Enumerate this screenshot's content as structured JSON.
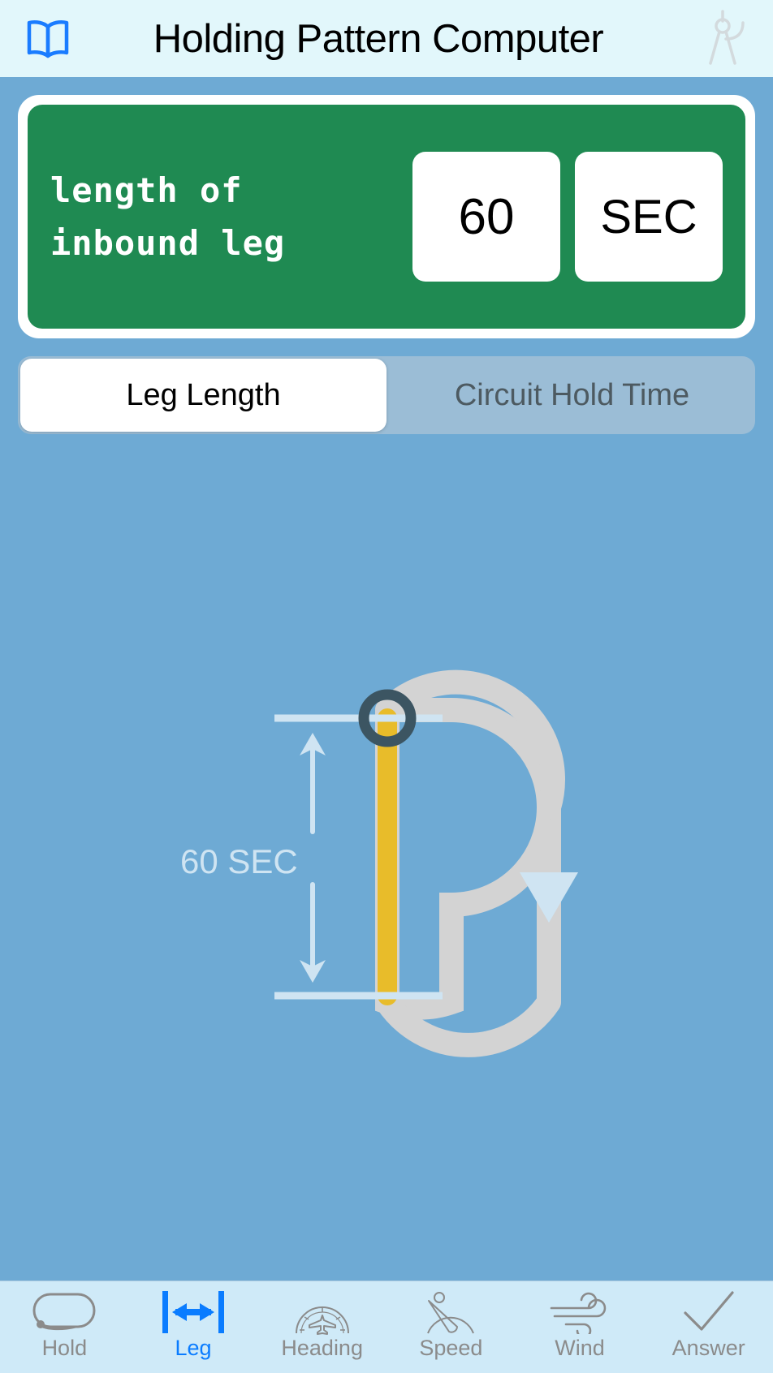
{
  "header": {
    "title": "Holding Pattern Computer",
    "book_icon": "book-icon",
    "compass_icon": "compass-divider-icon"
  },
  "input_card": {
    "label_line1": "length of",
    "label_line2": "inbound leg",
    "value": "60",
    "unit": "SEC",
    "card_color": "#1f8a52"
  },
  "segmented_control": {
    "options": [
      {
        "label": "Leg Length",
        "selected": true
      },
      {
        "label": "Circuit Hold Time",
        "selected": false
      }
    ]
  },
  "diagram": {
    "dimension_label": "60 SEC",
    "inbound_leg_color": "#e8bc2a",
    "track_color": "#d3d3d3",
    "fix_color": "#3c5562",
    "annotation_color": "#cfe4f2",
    "background_color": "#6eaad4"
  },
  "tabbar": {
    "items": [
      {
        "label": "Hold",
        "icon": "holding-pattern-icon",
        "active": false
      },
      {
        "label": "Leg",
        "icon": "leg-length-arrow-icon",
        "active": true
      },
      {
        "label": "Heading",
        "icon": "heading-compass-icon",
        "active": false
      },
      {
        "label": "Speed",
        "icon": "speed-gauge-icon",
        "active": false
      },
      {
        "label": "Wind",
        "icon": "wind-icon",
        "active": false
      },
      {
        "label": "Answer",
        "icon": "checkmark-icon",
        "active": false
      }
    ],
    "active_color": "#0a7cff",
    "inactive_color": "#8b8b8b"
  }
}
